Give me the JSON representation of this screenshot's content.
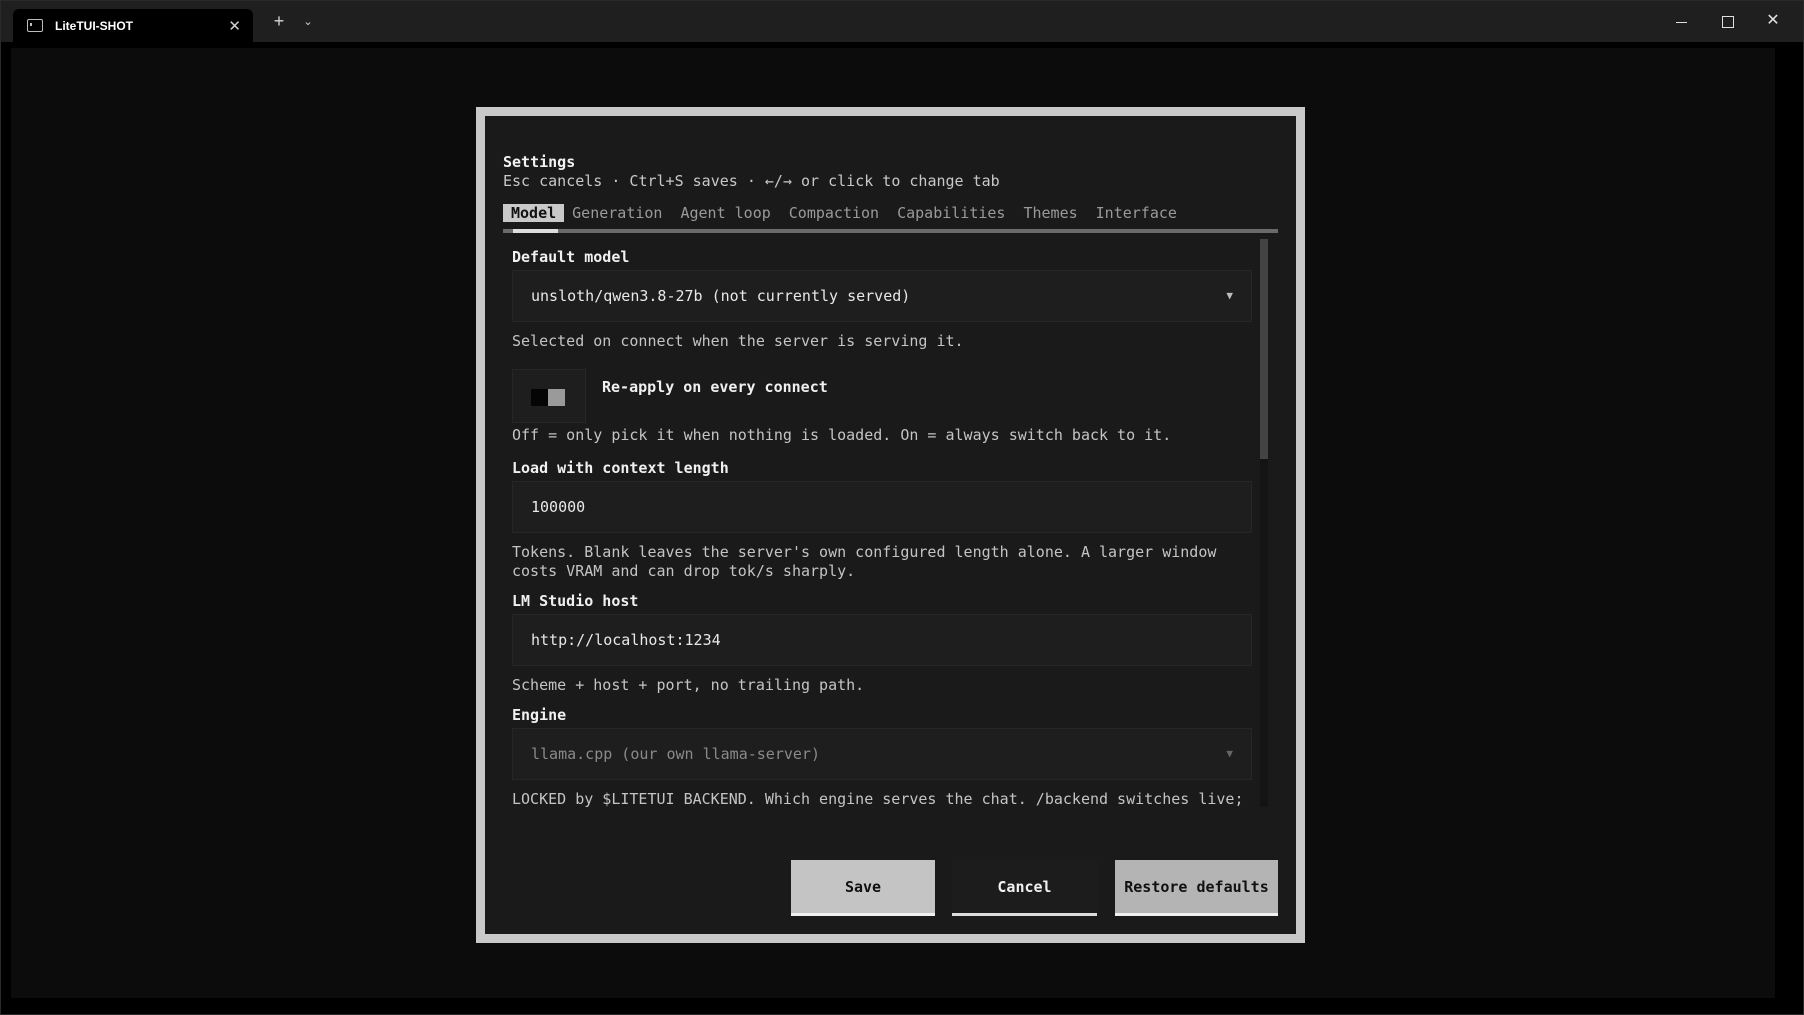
{
  "window": {
    "tab_title": "LiteTUI-SHOT",
    "icons": {
      "tab": "terminal-icon",
      "tab_close": "close-icon",
      "new_tab": "plus-icon",
      "dropdown": "chevron-down-icon",
      "minimize": "minimize-icon",
      "maximize": "maximize-icon",
      "close": "close-icon"
    },
    "glyphs": {
      "tab_close": "✕",
      "new_tab": "+",
      "dropdown": "⌄",
      "close": "✕"
    }
  },
  "dialog": {
    "title": "Settings",
    "hint": "Esc cancels · Ctrl+S saves · ←/→ or click to change tab",
    "tabs": [
      {
        "label": "Model",
        "active": true
      },
      {
        "label": "Generation",
        "active": false
      },
      {
        "label": "Agent loop",
        "active": false
      },
      {
        "label": "Compaction",
        "active": false
      },
      {
        "label": "Capabilities",
        "active": false
      },
      {
        "label": "Themes",
        "active": false
      },
      {
        "label": "Interface",
        "active": false
      }
    ],
    "fields": {
      "default_model": {
        "label": "Default model",
        "value": "unsloth/qwen3.8-27b  (not currently served)",
        "help": "Selected on connect when the server is serving it.",
        "caret": "▼"
      },
      "reapply": {
        "label": "Re-apply on every connect",
        "state": "off",
        "help": "Off = only pick it when nothing is loaded. On = always switch back to it."
      },
      "context_length": {
        "label": "Load with context length",
        "value": "100000",
        "help": "Tokens. Blank leaves the server's own configured length alone. A larger window costs VRAM and can drop tok/s sharply."
      },
      "host": {
        "label": "LM Studio host",
        "value": "http://localhost:1234",
        "help": "Scheme + host + port, no trailing path."
      },
      "engine": {
        "label": "Engine",
        "value": "llama.cpp (our own llama-server)",
        "help": "LOCKED by $LITETUI_BACKEND.  Which engine serves the chat. /backend switches live; this is the boot default.",
        "caret": "▼",
        "locked": true
      }
    },
    "buttons": {
      "save": "Save",
      "cancel": "Cancel",
      "restore": "Restore defaults"
    }
  },
  "colors": {
    "dialog_border": "#c9c9c9",
    "dialog_bg": "#1a1a1a",
    "active_tab_bg": "#c9c9c9"
  }
}
